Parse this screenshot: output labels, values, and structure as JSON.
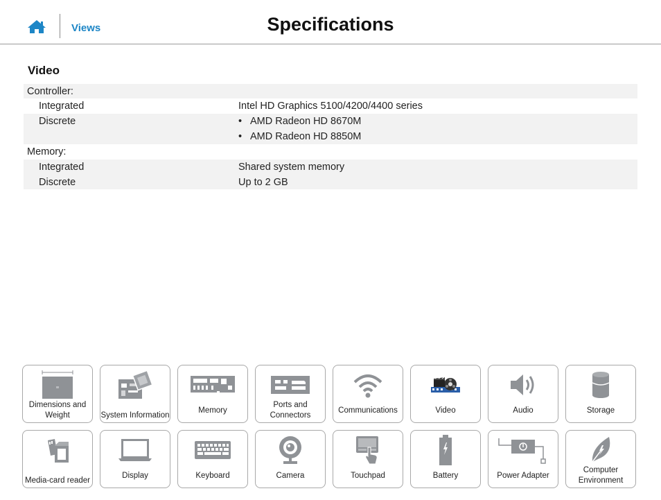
{
  "header": {
    "home_icon": "home-icon",
    "views_label": "Views",
    "title": "Specifications"
  },
  "section": {
    "title": "Video"
  },
  "rows": {
    "controller": {
      "label": "Controller:"
    },
    "controller_integrated": {
      "label": "Integrated",
      "value": "Intel HD Graphics 5100/4200/4400 series"
    },
    "controller_discrete": {
      "label": "Discrete",
      "values": [
        "AMD Radeon HD 8670M",
        "AMD Radeon HD 8850M"
      ]
    },
    "memory": {
      "label": "Memory:"
    },
    "memory_integrated": {
      "label": "Integrated",
      "value": "Shared system memory"
    },
    "memory_discrete": {
      "label": "Discrete",
      "value": "Up to 2 GB"
    }
  },
  "bullet_char": "•",
  "nav": {
    "tiles": [
      {
        "label": "Dimensions and Weight",
        "icon": "laptop-dimensions-icon"
      },
      {
        "label": "System Information",
        "icon": "system-board-icon"
      },
      {
        "label": "Memory",
        "icon": "memory-module-icon"
      },
      {
        "label": "Ports and Connectors",
        "icon": "ports-icon"
      },
      {
        "label": "Communications",
        "icon": "wifi-icon"
      },
      {
        "label": "Video",
        "icon": "video-film-icon"
      },
      {
        "label": "Audio",
        "icon": "speaker-icon"
      },
      {
        "label": "Storage",
        "icon": "storage-cylinder-icon"
      },
      {
        "label": "Media-card reader",
        "icon": "media-card-icon"
      },
      {
        "label": "Display",
        "icon": "laptop-display-icon"
      },
      {
        "label": "Keyboard",
        "icon": "keyboard-icon"
      },
      {
        "label": "Camera",
        "icon": "webcam-icon"
      },
      {
        "label": "Touchpad",
        "icon": "touchpad-icon"
      },
      {
        "label": "Battery",
        "icon": "battery-icon"
      },
      {
        "label": "Power Adapter",
        "icon": "power-adapter-icon"
      },
      {
        "label": "Computer Environment",
        "icon": "leaf-icon"
      }
    ]
  },
  "colors": {
    "accent": "#1d86c6",
    "icon_gray": "#8f9296",
    "row_shade": "#f2f2f2",
    "tile_border": "#a8a8a8"
  }
}
